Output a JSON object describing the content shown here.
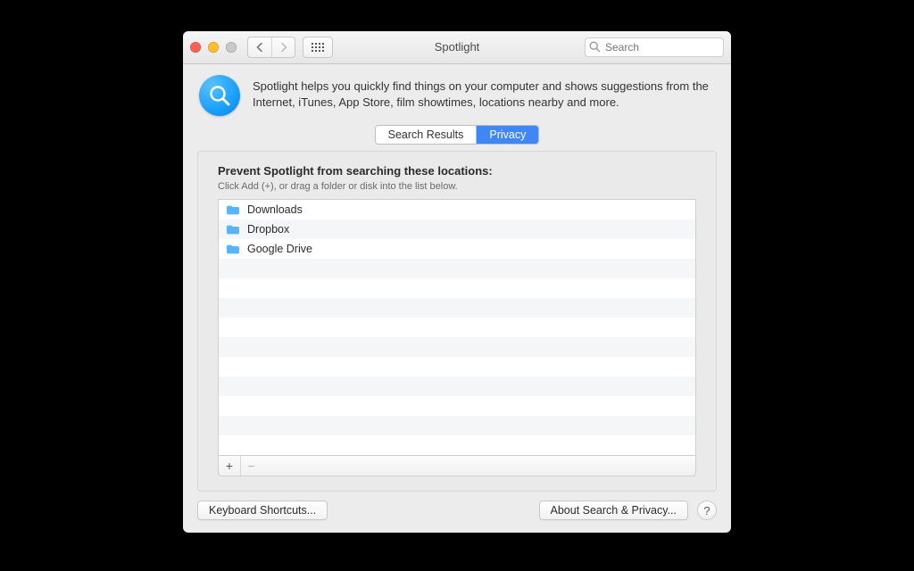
{
  "window": {
    "title": "Spotlight"
  },
  "toolbar": {
    "search_placeholder": "Search"
  },
  "header": {
    "description": "Spotlight helps you quickly find things on your computer and shows suggestions from the Internet, iTunes, App Store, film showtimes, locations nearby and more."
  },
  "tabs": {
    "search_results": "Search Results",
    "privacy": "Privacy",
    "active": "privacy"
  },
  "panel": {
    "heading": "Prevent Spotlight from searching these locations:",
    "subtext": "Click Add (+), or drag a folder or disk into the list below.",
    "items": [
      {
        "label": "Downloads"
      },
      {
        "label": "Dropbox"
      },
      {
        "label": "Google Drive"
      }
    ]
  },
  "footer": {
    "keyboard_shortcuts": "Keyboard Shortcuts...",
    "about": "About Search & Privacy...",
    "help": "?"
  },
  "glyphs": {
    "plus": "+",
    "minus": "−"
  }
}
